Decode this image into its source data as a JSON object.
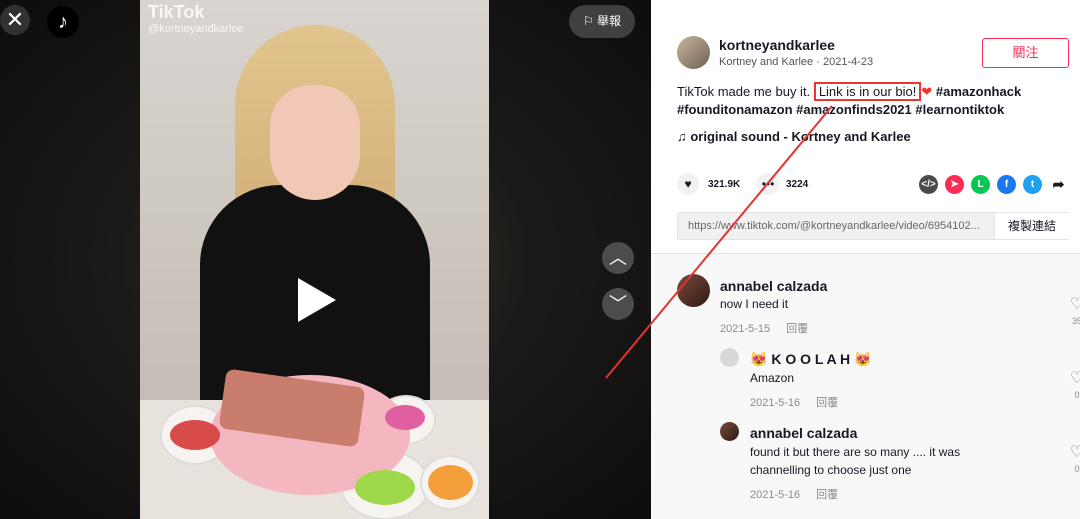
{
  "video": {
    "close_glyph": "✕",
    "logo_glyph": "♪",
    "watermark_title": "TikTok",
    "watermark_handle": "@kortneyandkarlee",
    "report_label": "⚐ 舉報",
    "up_glyph": "︿",
    "down_glyph": "﹀"
  },
  "author": {
    "username": "kortneyandkarlee",
    "display_name": "Kortney and Karlee",
    "date": "2021-4-23",
    "follow_label": "關注"
  },
  "caption": {
    "text_before": "TikTok made me buy it.",
    "highlight": "Link is in our bio!",
    "heart": "❤",
    "tags": "#amazonhack #founditonamazon #amazonfinds2021 #learnontiktok"
  },
  "sound": {
    "label": "♫  original sound - Kortney and Karlee"
  },
  "stats": {
    "likes": "321.9K",
    "comments": "3224"
  },
  "share": {
    "colors": {
      "embed": "#4a4a4a",
      "send": "#fe2c55",
      "line": "#06c755",
      "facebook": "#1877f2",
      "twitter": "#1da1f2"
    }
  },
  "link": {
    "url": "https://www.tiktok.com/@kortneyandkarlee/video/6954102...",
    "copy_label": "複製連結"
  },
  "comments": [
    {
      "name": "annabel calzada",
      "text": "now I need it",
      "date": "2021-5-15",
      "reply_label": "回覆",
      "likes": "35"
    },
    {
      "name": "😻 K O O L A H 😻",
      "text": "Amazon",
      "date": "2021-5-16",
      "reply_label": "回覆",
      "likes": "0"
    },
    {
      "name": "annabel calzada",
      "text": "found it but there are so many .... it was channelling to choose just one",
      "date": "2021-5-16",
      "reply_label": "回覆",
      "likes": "0"
    }
  ],
  "colors": {
    "accent": "#fe2c55",
    "annotation": "#e33333"
  }
}
